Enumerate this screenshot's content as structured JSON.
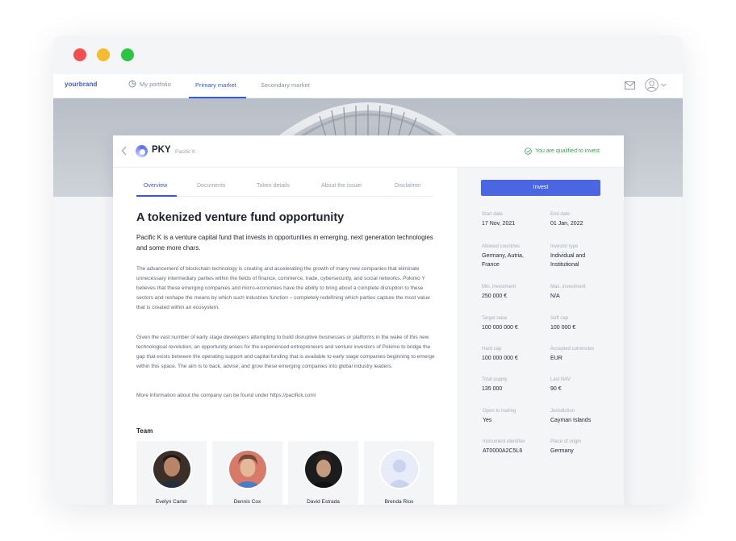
{
  "app": {
    "brand": "yourbrand",
    "nav": {
      "portfolio": "My portfolio",
      "primary": "Primary market",
      "secondary": "Secondary market"
    },
    "accent_color": "#3a57d6",
    "icons": [
      "mail-icon",
      "user-avatar-icon",
      "chevron-down-icon"
    ]
  },
  "header": {
    "ticker": "PKY",
    "name": "Pacific K",
    "qualified": "You are qualified to invest"
  },
  "tabs": [
    "Overview",
    "Documents",
    "Token details",
    "About the issuer",
    "Disclaimer"
  ],
  "main": {
    "title": "A tokenized venture fund opportunity",
    "lead": "Pacific K is a venture capital fund that invests in opportunities in emerging, next generation technologies and some more chars.",
    "p1": "The advancement of blockchain technology is creating and accelerating the growth of many new companies that eliminate unnecessary intermediary parties within the fields of finance, commerce, trade, cybersecurity, and social networks. Pokimo Y believes that these emerging companies and micro-economies have the ability to bring about a complete disruption to these sectors and reshape the means by which such industries function – completely redefining which parties capture the most value that is created within an ecosystem.",
    "p2": "Given the vast number of early stage developers attempting to build disruptive businesses or platforms in the wake of this new technological revolution, an opportunity arises for the experienced entrepreneurs and venture investors of Pokimo to bridge the gap that exists between the operating support and capital funding that is available to early stage companies beginning to emerge within this space. The aim is to back, advise, and grow these emerging companies into global industry leaders.",
    "p3": "More information about the company can be found under https://pacifick.com/",
    "team_title": "Team",
    "team": [
      "Evelyn Carter",
      "Dennis Cox",
      "David Estrada",
      "Brenda Rios"
    ]
  },
  "sidebar": {
    "invest_label": "Invest",
    "fields": [
      {
        "label": "Start date",
        "value": "17 Nov, 2021"
      },
      {
        "label": "End date",
        "value": "01 Jan, 2022"
      },
      {
        "label": "Allowed countries",
        "value": "Germany, Autria, France"
      },
      {
        "label": "Investor type",
        "value": "Individual and Institutional"
      },
      {
        "label": "Min. investment",
        "value": "250 000 €"
      },
      {
        "label": "Max. investment",
        "value": "N/A"
      },
      {
        "label": "Target raise",
        "value": "100 000 000 €"
      },
      {
        "label": "Soft cap",
        "value": "100 000 €"
      },
      {
        "label": "Hard cap",
        "value": "100 000 000 €"
      },
      {
        "label": "Accepted currencies",
        "value": "EUR"
      },
      {
        "label": "Total supply",
        "value": "135 000"
      },
      {
        "label": "Last NAV",
        "value": "90 €"
      },
      {
        "label": "Open to trading",
        "value": "Yes"
      },
      {
        "label": "Jurisdiction",
        "value": "Cayman Islands"
      },
      {
        "label": "Instrument identifier",
        "value": "AT0000A2C5L6"
      },
      {
        "label": "Place of origin",
        "value": "Germany"
      }
    ]
  }
}
